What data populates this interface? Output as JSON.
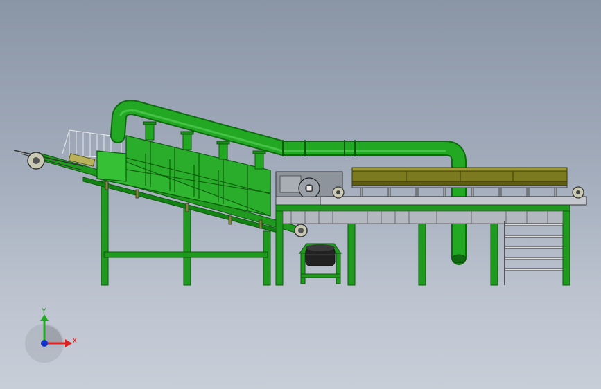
{
  "viewport": {
    "background_top": "#8a95a6",
    "background_bottom": "#c8ced8"
  },
  "colors": {
    "frame_green": "#1f9a1f",
    "frame_green_dark": "#0f6a0f",
    "duct_green": "#22a822",
    "panel_green": "#2fb52f",
    "panel_green_dark": "#1c8f1c",
    "olive_hopper": "#7b7a1e",
    "olive_hopper_dark": "#5d5c10",
    "machine_gray": "#8e949c",
    "steel_light": "#c4c8ce"
  },
  "triad": {
    "y_label": "Y",
    "x_label": "X",
    "y_color": "#22aa22",
    "x_color": "#dd2222",
    "z_color": "#1133cc"
  }
}
